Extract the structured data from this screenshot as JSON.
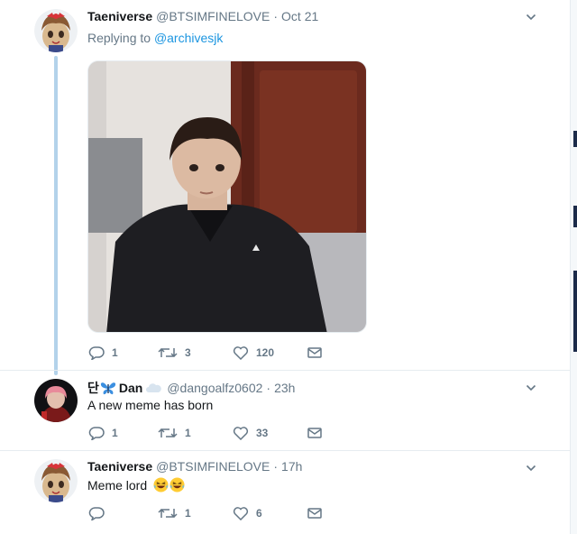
{
  "colors": {
    "link": "#1b95e0",
    "thread_line": "#b3d2ea",
    "meta_text": "#657786",
    "divider": "#e6ecf0"
  },
  "tweets": [
    {
      "display_name": "Taeniverse",
      "handle": "@BTSIMFINELOVE",
      "time": "Oct 21",
      "replying_prefix": "Replying to",
      "replying_to": "@archivesjk",
      "has_photo": true,
      "replies": "1",
      "retweets": "3",
      "likes": "120",
      "icons": [
        "reply-icon",
        "retweet-icon",
        "like-icon",
        "direct-message-icon",
        "chevron-down-icon"
      ]
    },
    {
      "name_prefix": "단",
      "display_name": "Dan",
      "handle": "@dangoalfz0602",
      "time": "23h",
      "text": "A new meme has born",
      "replies": "1",
      "retweets": "1",
      "likes": "33",
      "icons": [
        "butterfly-icon",
        "cloud-icon"
      ]
    },
    {
      "display_name": "Taeniverse",
      "handle": "@BTSIMFINELOVE",
      "time": "17h",
      "text": "Meme lord",
      "emoji": [
        "laughing-face-icon",
        "laughing-face-icon"
      ],
      "replies": "",
      "retweets": "1",
      "likes": "6"
    }
  ]
}
